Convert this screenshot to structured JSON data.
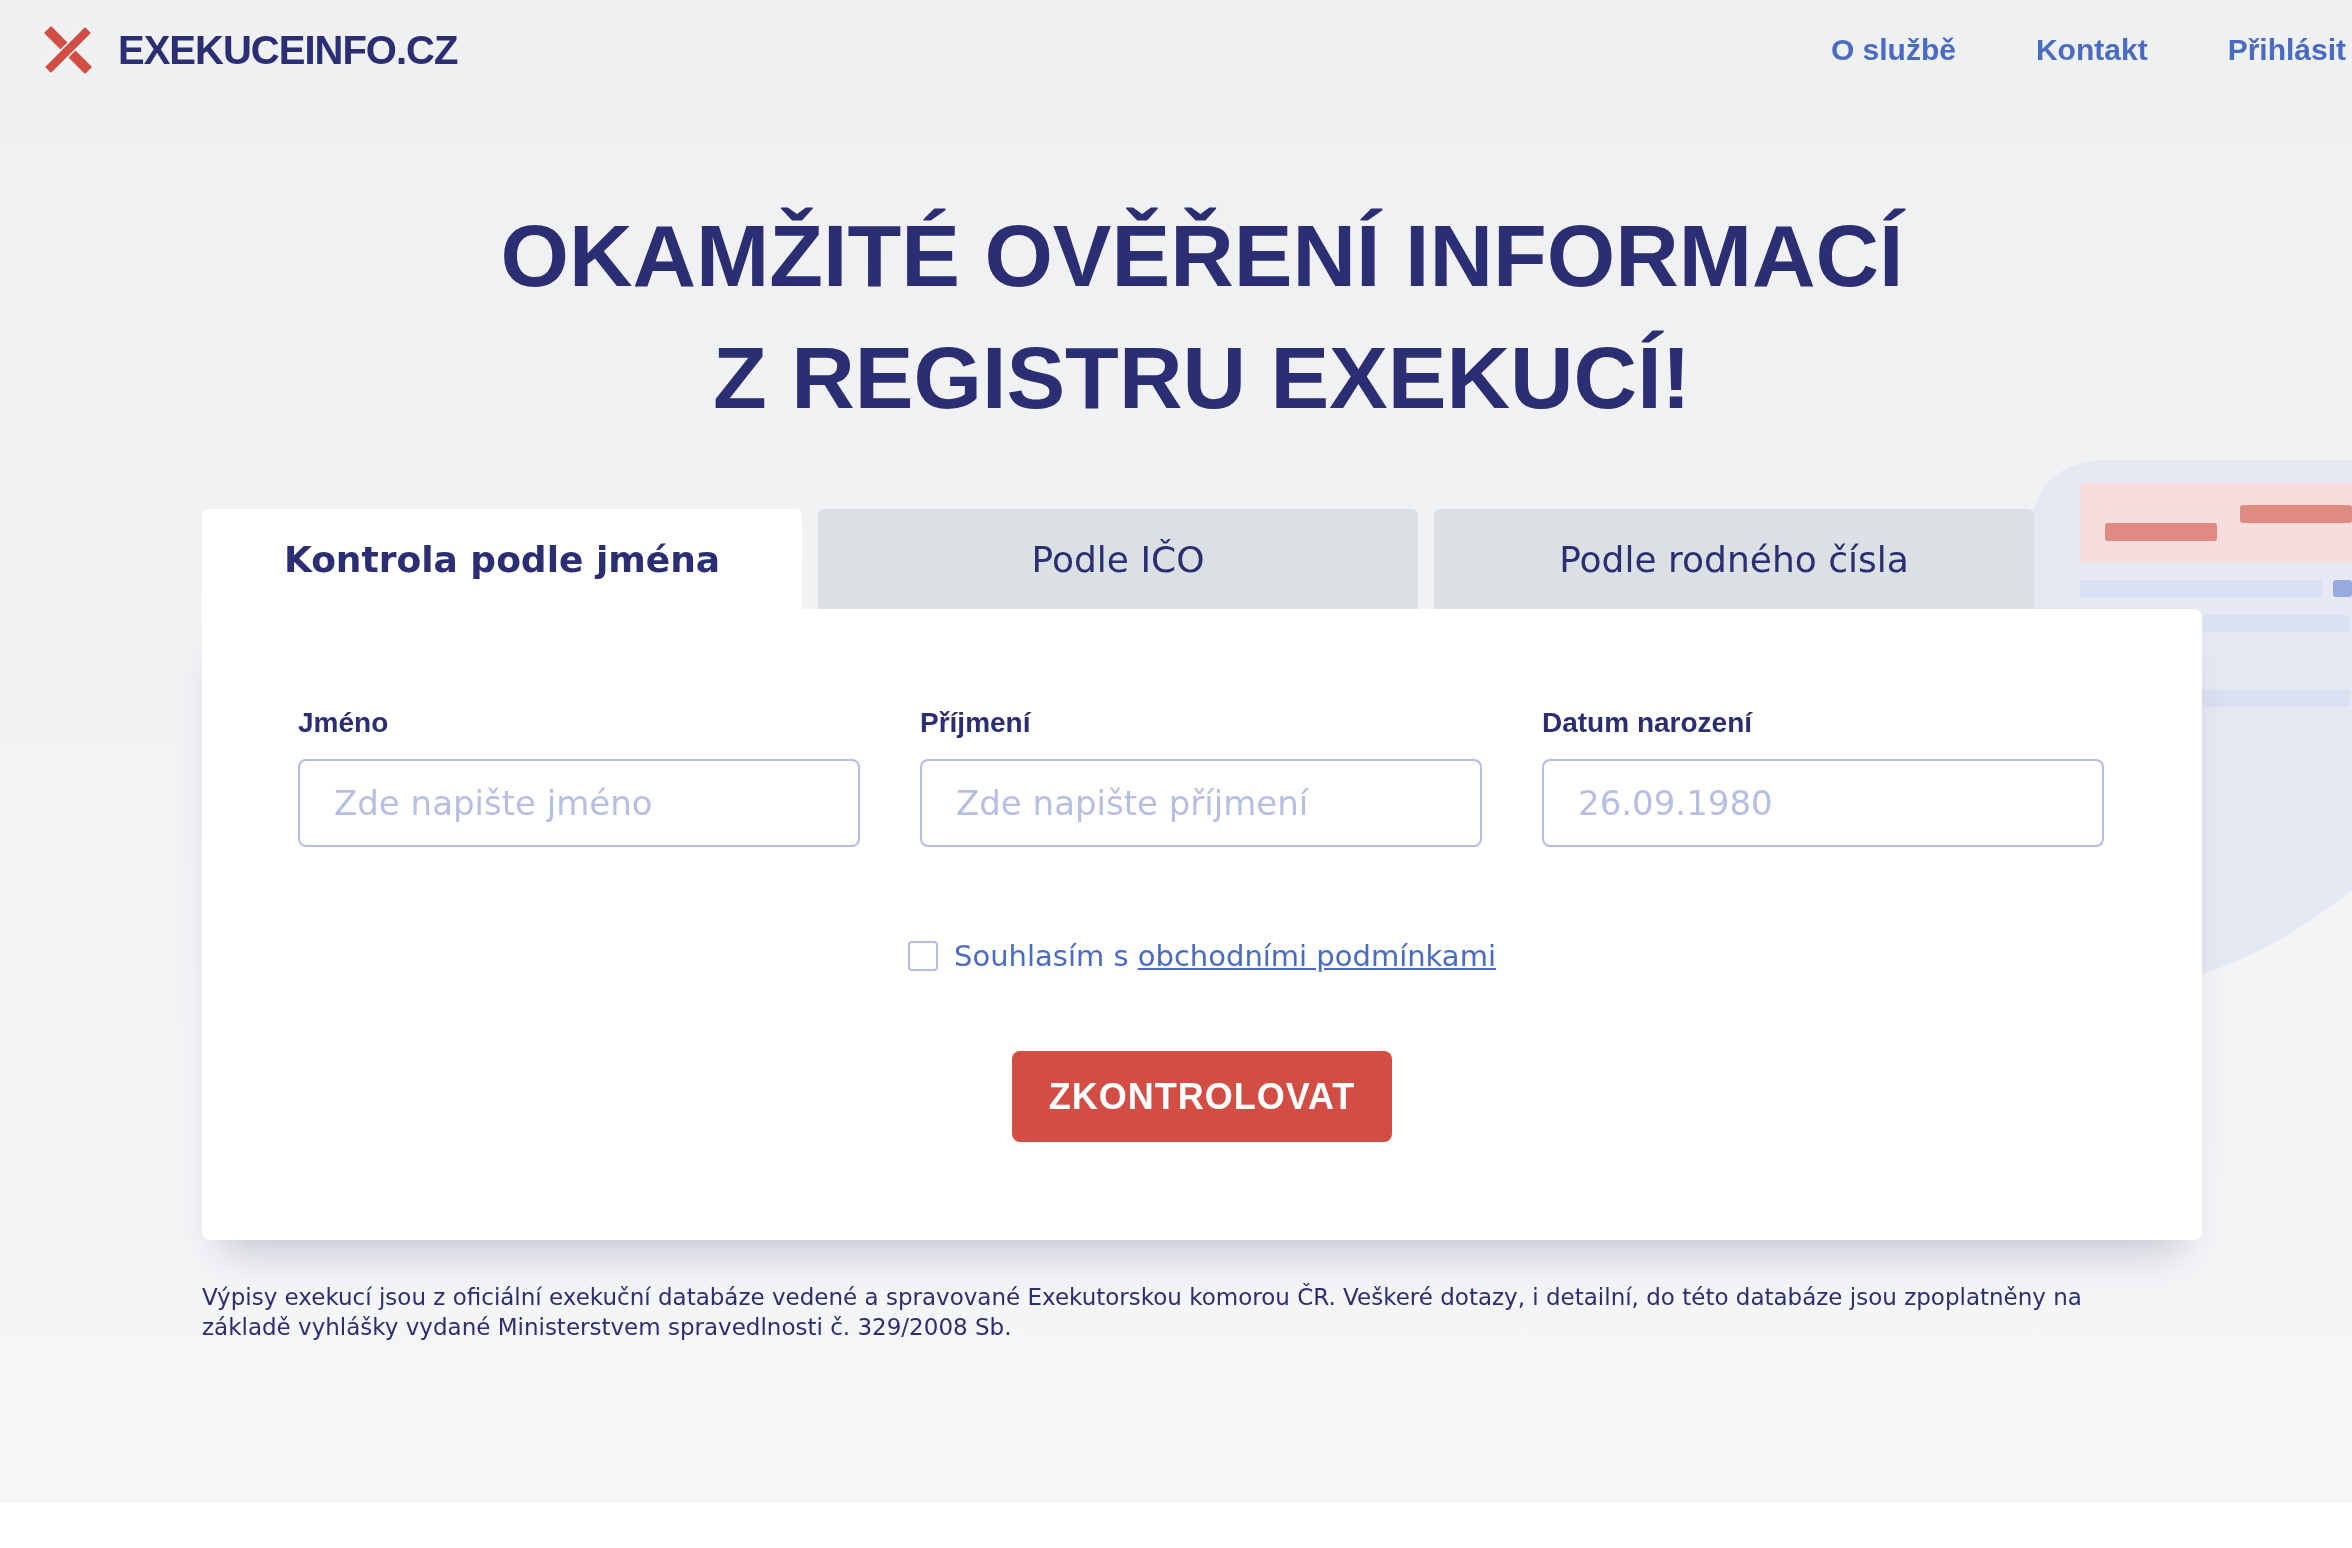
{
  "header": {
    "brand": "EXEKUCEINFO.CZ",
    "nav": [
      {
        "label": "O službě"
      },
      {
        "label": "Kontakt"
      },
      {
        "label": "Přihlásit"
      }
    ]
  },
  "headline": [
    "OKAMŽITÉ OVĚŘENÍ INFORMACÍ",
    "Z REGISTRU EXEKUCÍ!"
  ],
  "tabs": [
    {
      "label": "Kontrola podle jména",
      "selected": true
    },
    {
      "label": "Podle IČO",
      "selected": false
    },
    {
      "label": "Podle rodného čísla",
      "selected": false
    }
  ],
  "fields": [
    {
      "label": "Jméno",
      "placeholder": "Zde napište jméno"
    },
    {
      "label": "Příjmení",
      "placeholder": "Zde napište příjmení"
    },
    {
      "label": "Datum narození",
      "placeholder": "26.09.1980"
    }
  ],
  "consent": {
    "checked": false,
    "text": "Souhlasím s",
    "link": "obchodními podmínkami"
  },
  "submit": "ZKONTROLOVAT",
  "footnote": "Výpisy exekucí jsou z oficiální exekuční databáze vedené a spravované Exekutorskou komorou ČR. Veškeré dotazy, i detailní, do této databáze jsou zpoplatněny na základě vyhlášky vydané Ministerstvem spravedlnosti č. 329/2008 Sb."
}
